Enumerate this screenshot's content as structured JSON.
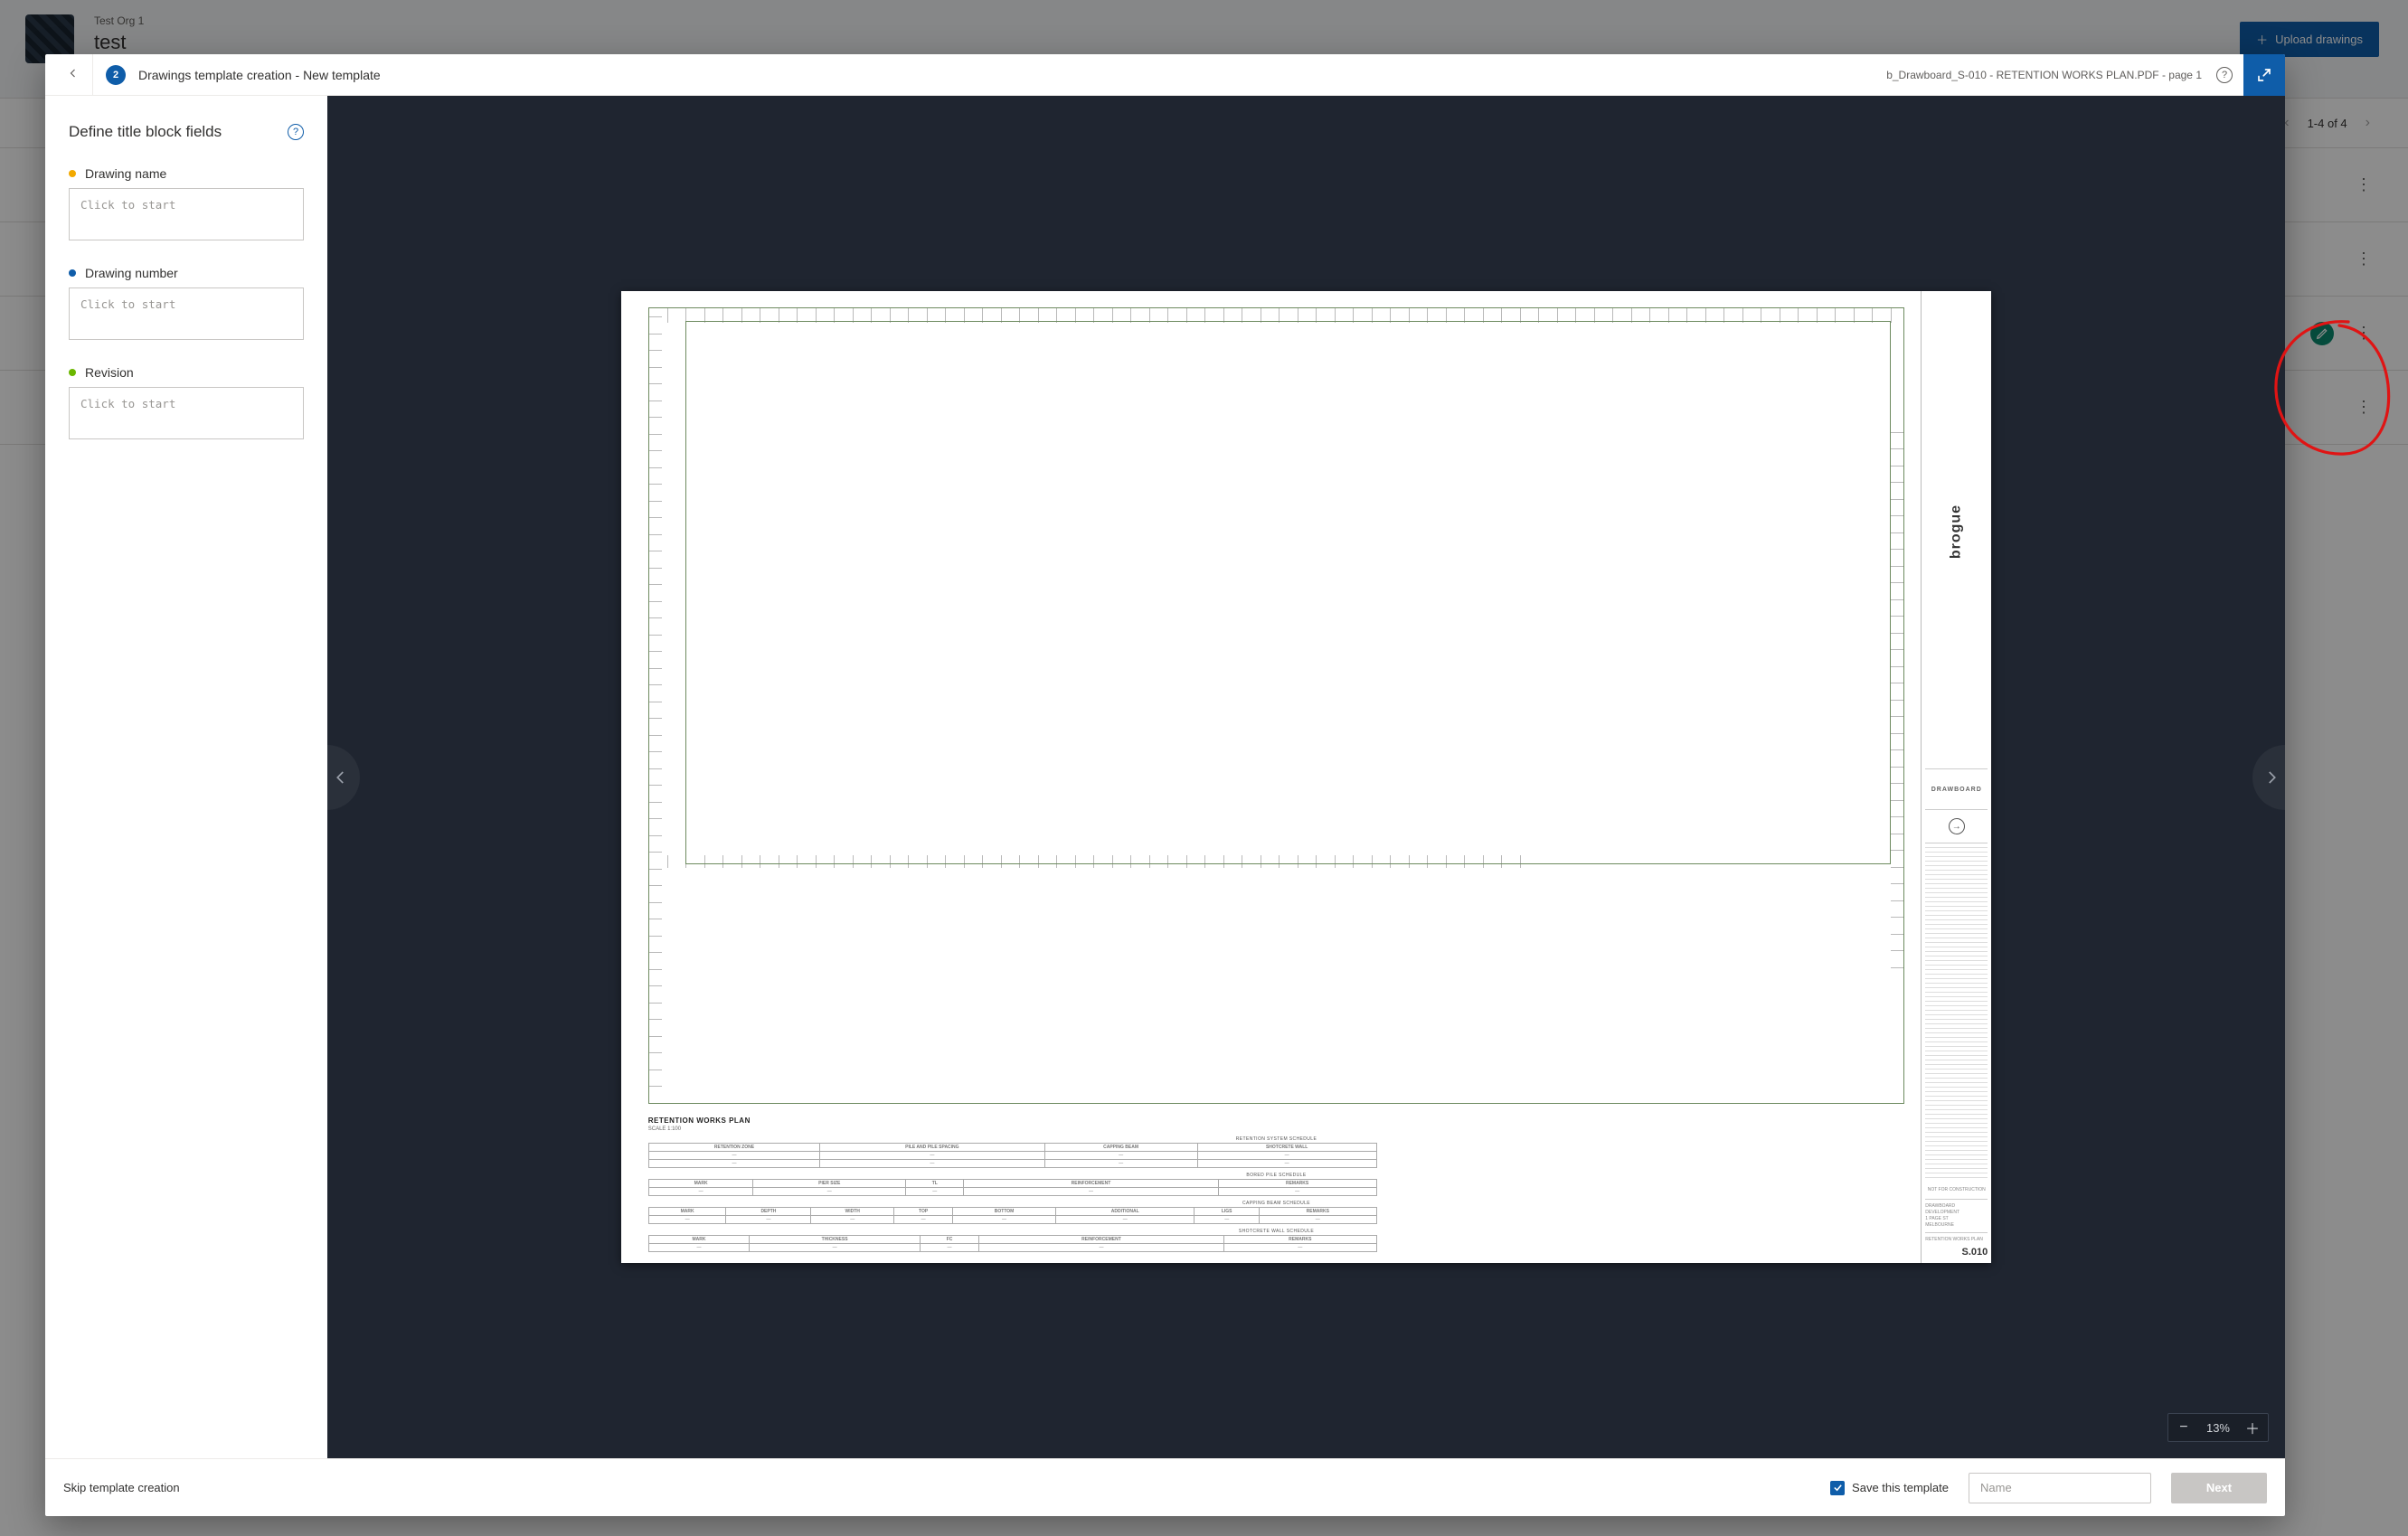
{
  "bg": {
    "org": "Test Org 1",
    "project": "test",
    "upload_btn": "Upload drawings",
    "pager": "1-4  of  4",
    "rows": [
      {
        "badge": false
      },
      {
        "badge": false
      },
      {
        "badge": true,
        "badge_icon": "pencil"
      },
      {
        "badge": false
      }
    ]
  },
  "modal": {
    "step_number": "2",
    "header_title": "Drawings template creation - New template",
    "file_label": "b_Drawboard_S-010 - RETENTION WORKS PLAN.PDF - page 1",
    "panel_title": "Define title block fields",
    "fields": [
      {
        "dot_class": "ora",
        "label": "Drawing name",
        "placeholder": "Click to start"
      },
      {
        "dot_class": "blu",
        "label": "Drawing number",
        "placeholder": "Click to start"
      },
      {
        "dot_class": "grn",
        "label": "Revision",
        "placeholder": "Click to start"
      }
    ],
    "zoom_value": "13%",
    "footer": {
      "skip_label": "Skip template creation",
      "save_label": "Save this template",
      "name_placeholder": "Name",
      "next_label": "Next"
    }
  },
  "drawing": {
    "plan_title": "RETENTION WORKS PLAN",
    "plan_subtitle": "SCALE 1:100",
    "schedules": [
      "RETENTION SYSTEM SCHEDULE",
      "BORED PILE SCHEDULE",
      "CAPPING BEAM SCHEDULE",
      "SHOTCRETE WALL SCHEDULE"
    ],
    "title_block": {
      "brand": "brogue",
      "logo_text": "DRAWBOARD",
      "nfc": "NOT FOR CONSTRUCTION",
      "project_line1": "DRAWBOARD DEVELOPMENT",
      "project_line2": "1 PAGE ST",
      "project_line3": "MELBOURNE",
      "sheet_desc": "RETENTION WORKS PLAN",
      "sheet_num": "S.010"
    }
  }
}
